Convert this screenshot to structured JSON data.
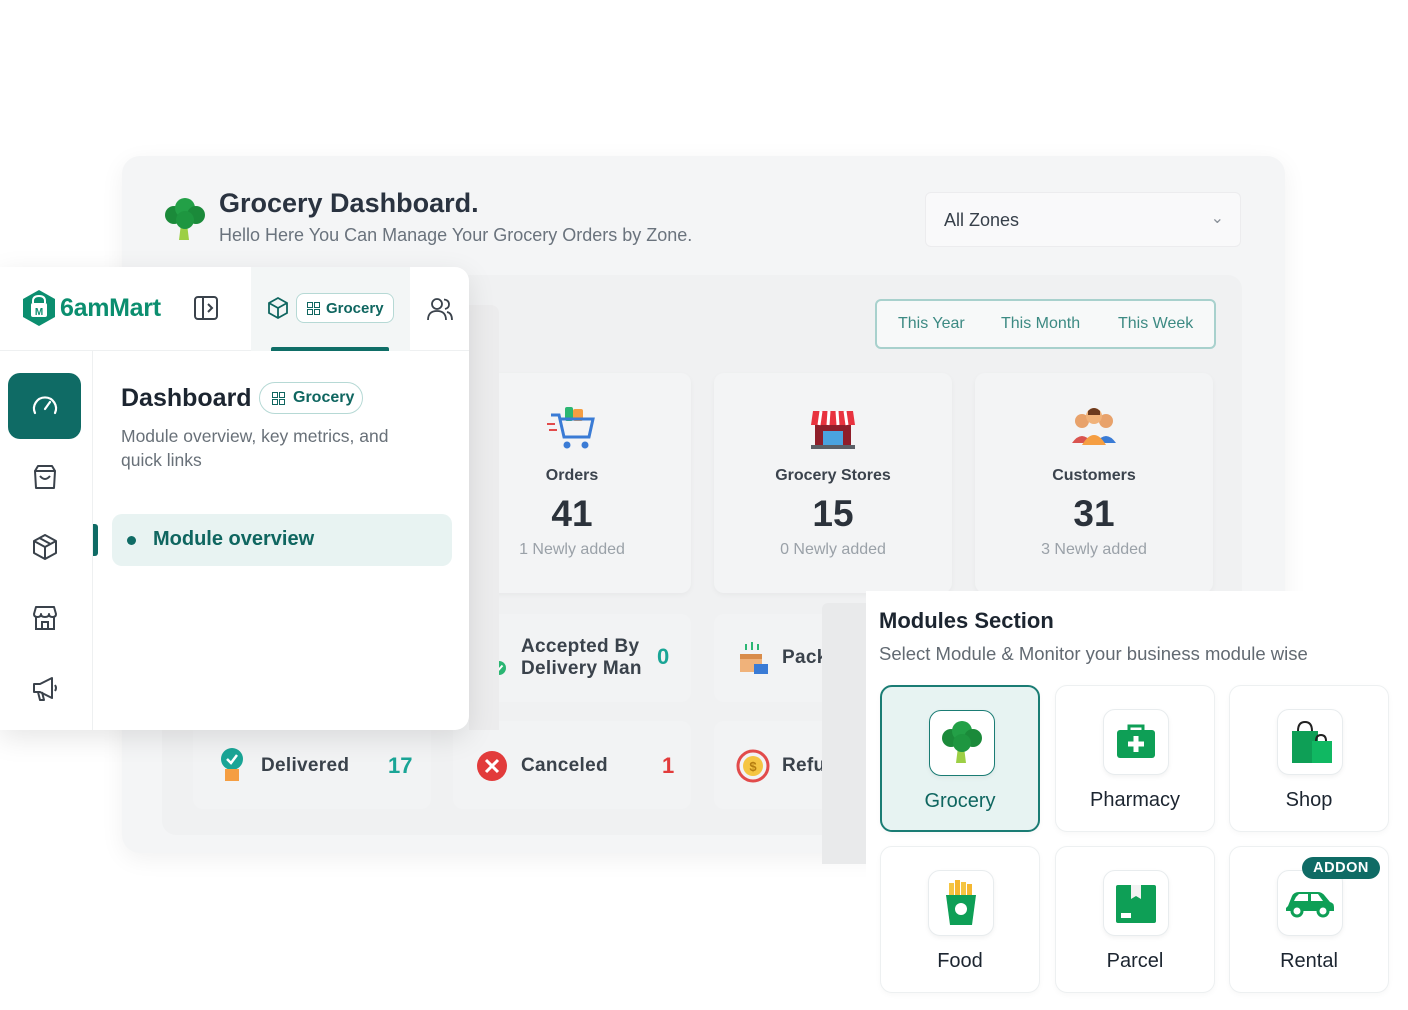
{
  "background_dashboard": {
    "title": "Grocery Dashboard.",
    "subtitle": "Hello Here You Can Manage Your Grocery Orders by Zone.",
    "zone_select": {
      "value": "All Zones"
    },
    "period_tabs": [
      "This Year",
      "This Month",
      "This Week"
    ],
    "stats": [
      {
        "label": "Orders",
        "value": "41",
        "note": "1 Newly added"
      },
      {
        "label": "Grocery Stores",
        "value": "15",
        "note": "0 Newly added"
      },
      {
        "label": "Customers",
        "value": "31",
        "note": "3 Newly added"
      }
    ],
    "order_status": [
      {
        "label_line1": "Accepted By",
        "label_line2": "Delivery Man",
        "value": "0"
      },
      {
        "label": "Packagin",
        "value": ""
      },
      {
        "label": "Delivered",
        "value": "17"
      },
      {
        "label": "Canceled",
        "value": "1"
      },
      {
        "label": "Refundec",
        "value": ""
      }
    ],
    "colors": {
      "teal": "#1aa596",
      "red": "#e23b3b"
    }
  },
  "sidebar": {
    "brand": "6amMart",
    "module_chip": "Grocery",
    "rail_icons": [
      "dashboard-gauge-icon",
      "shopping-bag-icon",
      "package-icon",
      "store-icon",
      "megaphone-icon"
    ],
    "page_title": "Dashboard",
    "page_chip": "Grocery",
    "page_desc": "Module overview, key metrics, and quick links",
    "nav_item": "Module overview"
  },
  "modules_section": {
    "title": "Modules Section",
    "subtitle": "Select Module & Monitor your business module wise",
    "modules": [
      {
        "name": "Grocery",
        "icon": "broccoli-icon",
        "selected": true
      },
      {
        "name": "Pharmacy",
        "icon": "first-aid-kit-icon",
        "selected": false
      },
      {
        "name": "Shop",
        "icon": "shopping-bags-icon",
        "selected": false
      },
      {
        "name": "Food",
        "icon": "fries-icon",
        "selected": false
      },
      {
        "name": "Parcel",
        "icon": "parcel-box-icon",
        "selected": false
      },
      {
        "name": "Rental",
        "icon": "car-icon",
        "selected": false,
        "badge": "ADDON"
      }
    ],
    "accent": "#0f6b65"
  }
}
